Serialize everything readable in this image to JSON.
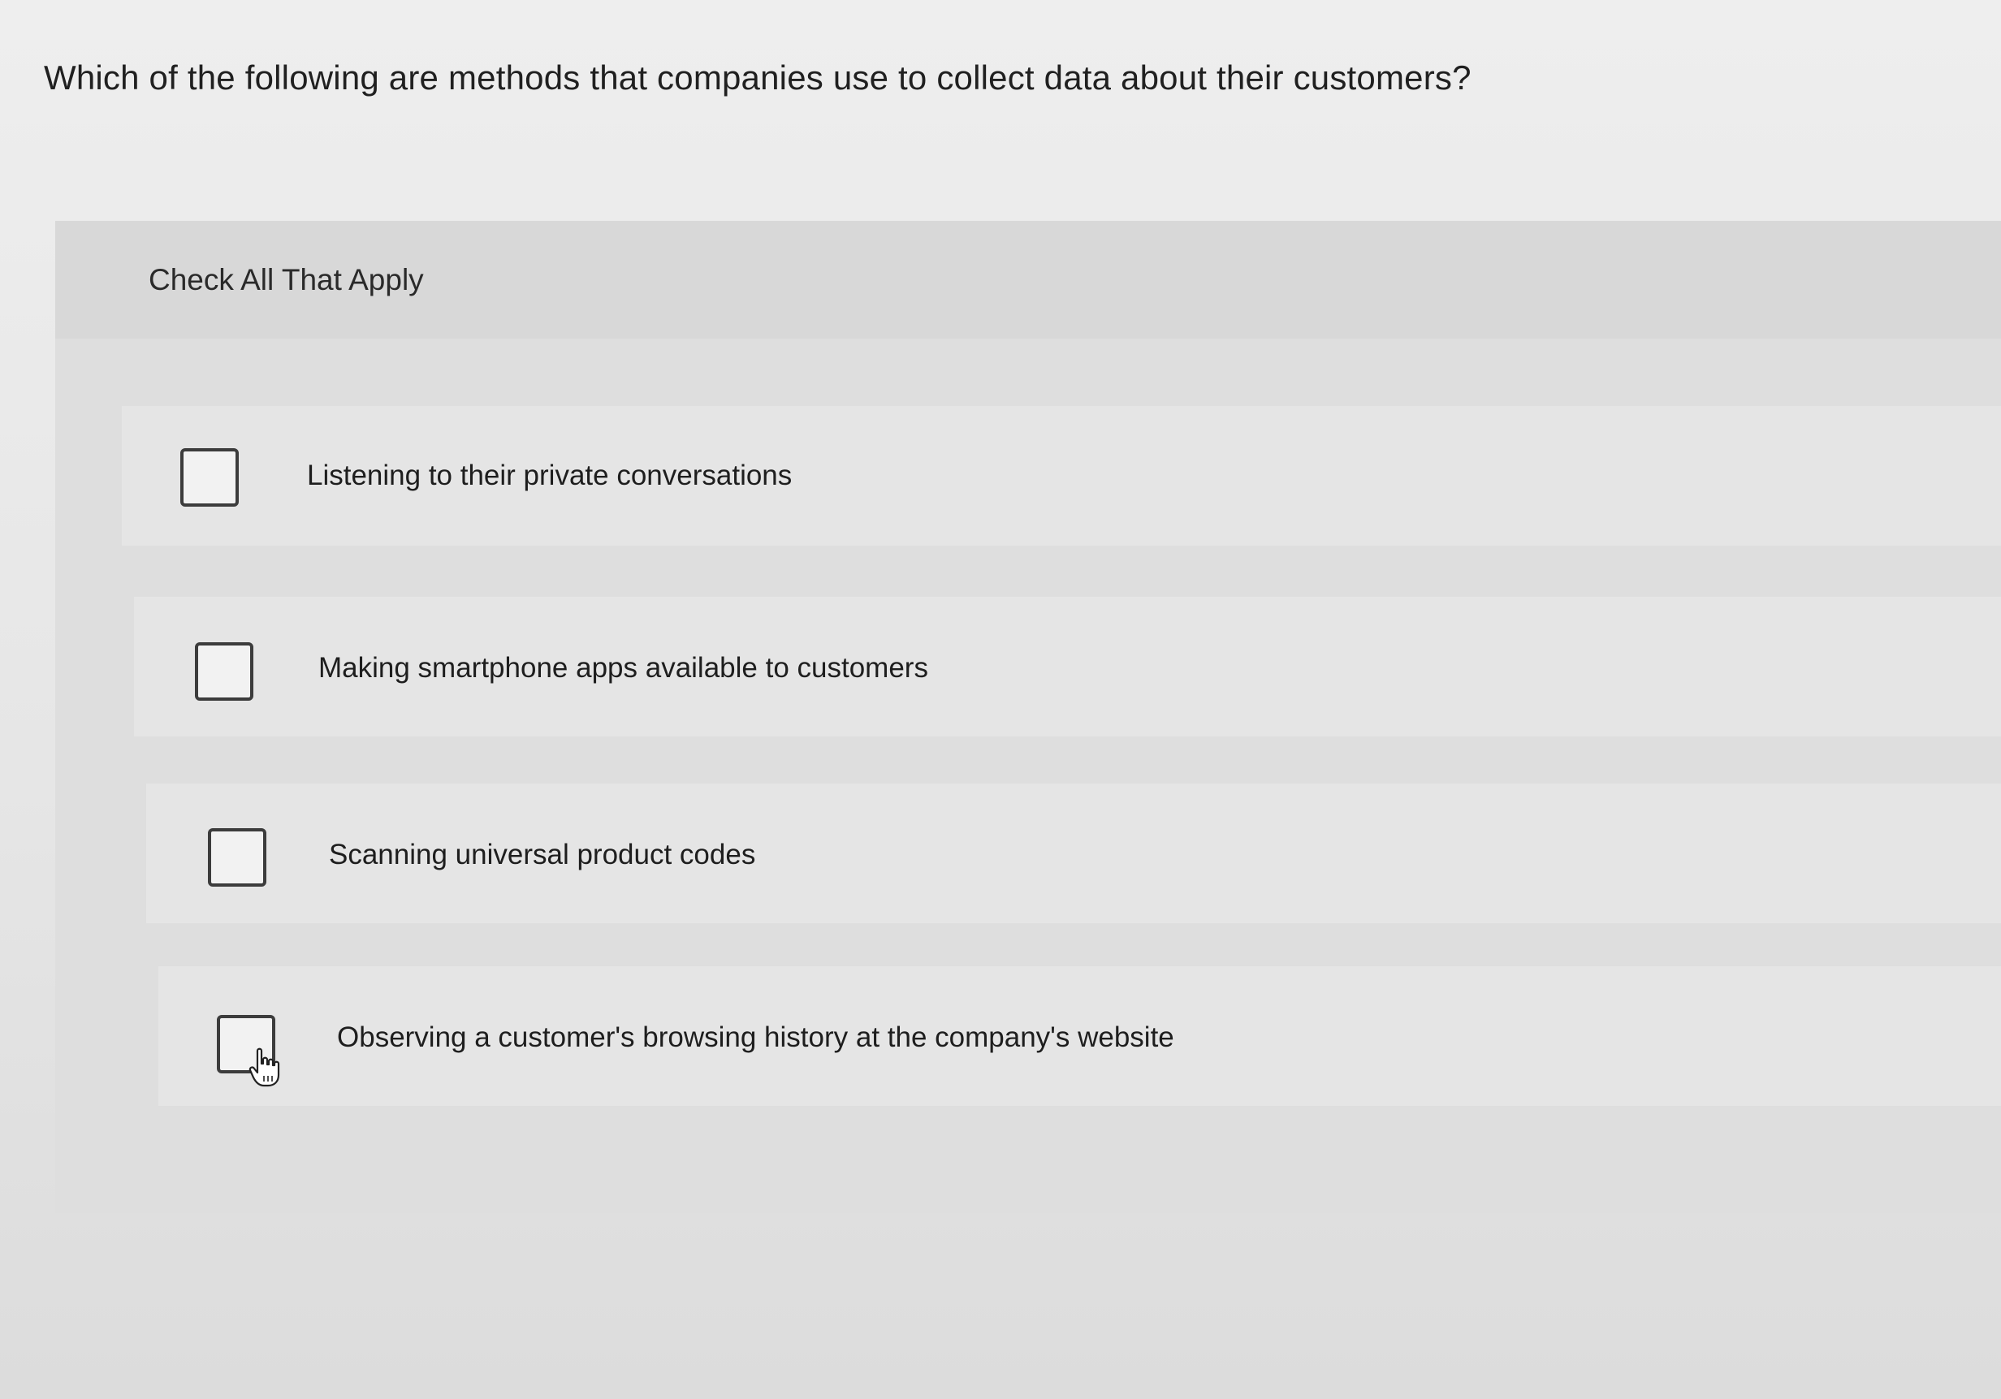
{
  "question": {
    "text": "Which of the following are methods that companies use to collect data about their customers?"
  },
  "panel": {
    "instructions": "Check All That Apply"
  },
  "options": [
    {
      "label": "Listening to their private conversations",
      "checked": false
    },
    {
      "label": "Making smartphone apps available to customers",
      "checked": false
    },
    {
      "label": "Scanning universal product codes",
      "checked": false
    },
    {
      "label": "Observing a customer's browsing history at the company's website",
      "checked": false
    }
  ],
  "icons": {
    "checkbox": "empty-square-checkbox",
    "cursor": "hand-pointer-icon"
  }
}
